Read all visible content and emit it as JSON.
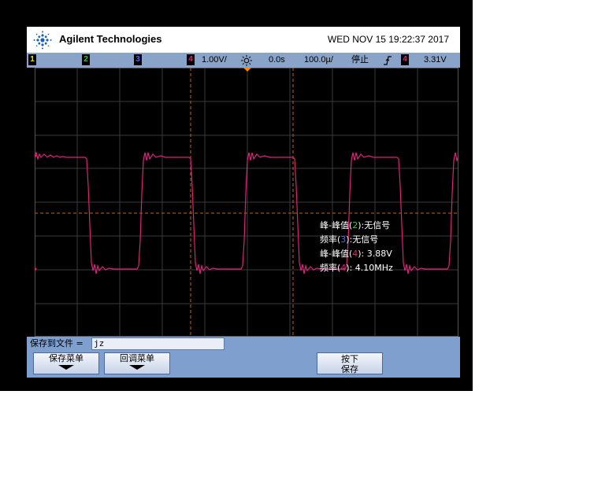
{
  "header": {
    "brand": "Agilent Technologies",
    "datetime": "WED NOV 15 19:22:37 2017"
  },
  "status": {
    "ch1": "1",
    "ch2": "2",
    "ch3": "3",
    "ch4": "4",
    "ch4_scale": "1.00V/",
    "delay": "0.0s",
    "timebase": "100.0µ/",
    "run_state": "停止",
    "trigger_ch": "4",
    "trigger_level": "3.31V"
  },
  "measurements": {
    "m1_prefix": "峰-峰值(",
    "m1_ch": "2",
    "m1_suffix": "):无信号",
    "m2_prefix": "频率(",
    "m2_ch": "3",
    "m2_suffix": "):无信号",
    "m3_prefix": "峰-峰值(",
    "m3_ch": "4",
    "m3_suffix": "): 3.88V",
    "m4_prefix": "频率(",
    "m4_ch": "4",
    "m4_suffix": "): 4.10MHz"
  },
  "softkeys": {
    "save_to_file_label": "保存到文件 =",
    "filename_value": "jz",
    "save_menu": "保存菜单",
    "recall_menu": "回调菜单",
    "press_line1": "按下",
    "press_line2": "保存"
  },
  "colors": {
    "ch1": "#e8e800",
    "ch2": "#33cc33",
    "ch3": "#4a6cff",
    "ch4": "#e0207a",
    "status_bg": "#8aa3c9",
    "softkey_bg": "#7f9fcf"
  }
}
